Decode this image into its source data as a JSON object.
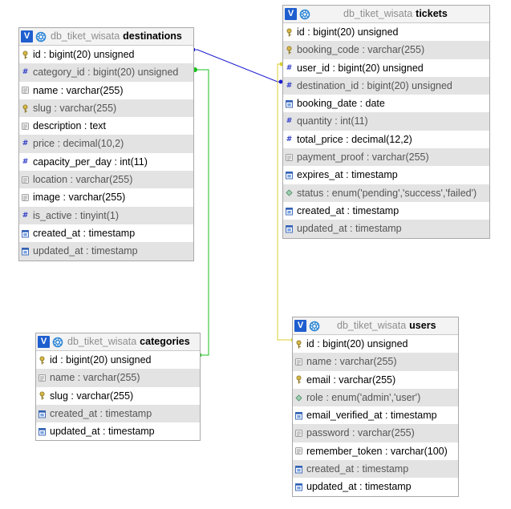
{
  "tables": {
    "destinations": {
      "db": "db_tiket_wisata",
      "name": "destinations",
      "columns": [
        {
          "label": "id : bigint(20) unsigned",
          "icon": "key"
        },
        {
          "label": "category_id : bigint(20) unsigned",
          "icon": "number"
        },
        {
          "label": "name : varchar(255)",
          "icon": "text"
        },
        {
          "label": "slug : varchar(255)",
          "icon": "key"
        },
        {
          "label": "description : text",
          "icon": "text"
        },
        {
          "label": "price : decimal(10,2)",
          "icon": "number"
        },
        {
          "label": "capacity_per_day : int(11)",
          "icon": "number"
        },
        {
          "label": "location : varchar(255)",
          "icon": "text"
        },
        {
          "label": "image : varchar(255)",
          "icon": "text"
        },
        {
          "label": "is_active : tinyint(1)",
          "icon": "number"
        },
        {
          "label": "created_at : timestamp",
          "icon": "date"
        },
        {
          "label": "updated_at : timestamp",
          "icon": "date"
        }
      ]
    },
    "tickets": {
      "db": "db_tiket_wisata",
      "name": "tickets",
      "columns": [
        {
          "label": "id : bigint(20) unsigned",
          "icon": "key"
        },
        {
          "label": "booking_code : varchar(255)",
          "icon": "key"
        },
        {
          "label": "user_id : bigint(20) unsigned",
          "icon": "number"
        },
        {
          "label": "destination_id : bigint(20) unsigned",
          "icon": "number"
        },
        {
          "label": "booking_date : date",
          "icon": "date"
        },
        {
          "label": "quantity : int(11)",
          "icon": "number"
        },
        {
          "label": "total_price : decimal(12,2)",
          "icon": "number"
        },
        {
          "label": "payment_proof : varchar(255)",
          "icon": "text"
        },
        {
          "label": "expires_at : timestamp",
          "icon": "date"
        },
        {
          "label": "status : enum('pending','success','failed')",
          "icon": "enum"
        },
        {
          "label": "created_at : timestamp",
          "icon": "date"
        },
        {
          "label": "updated_at : timestamp",
          "icon": "date"
        }
      ]
    },
    "categories": {
      "db": "db_tiket_wisata",
      "name": "categories",
      "columns": [
        {
          "label": "id : bigint(20) unsigned",
          "icon": "key"
        },
        {
          "label": "name : varchar(255)",
          "icon": "text"
        },
        {
          "label": "slug : varchar(255)",
          "icon": "key"
        },
        {
          "label": "created_at : timestamp",
          "icon": "date"
        },
        {
          "label": "updated_at : timestamp",
          "icon": "date"
        }
      ]
    },
    "users": {
      "db": "db_tiket_wisata",
      "name": "users",
      "columns": [
        {
          "label": "id : bigint(20) unsigned",
          "icon": "key"
        },
        {
          "label": "name : varchar(255)",
          "icon": "text"
        },
        {
          "label": "email : varchar(255)",
          "icon": "key"
        },
        {
          "label": "role : enum('admin','user')",
          "icon": "enum"
        },
        {
          "label": "email_verified_at : timestamp",
          "icon": "date"
        },
        {
          "label": "password : varchar(255)",
          "icon": "text"
        },
        {
          "label": "remember_token : varchar(100)",
          "icon": "text"
        },
        {
          "label": "created_at : timestamp",
          "icon": "date"
        },
        {
          "label": "updated_at : timestamp",
          "icon": "date"
        }
      ]
    }
  },
  "toggle_label": "V",
  "relations": [
    {
      "from": "destinations.category_id",
      "to": "categories.id",
      "color": "#1bbf1b"
    },
    {
      "from": "tickets.destination_id",
      "to": "destinations.id",
      "color": "#1a1ad0"
    },
    {
      "from": "tickets.user_id",
      "to": "users.id",
      "color": "#d9cf2c"
    }
  ]
}
